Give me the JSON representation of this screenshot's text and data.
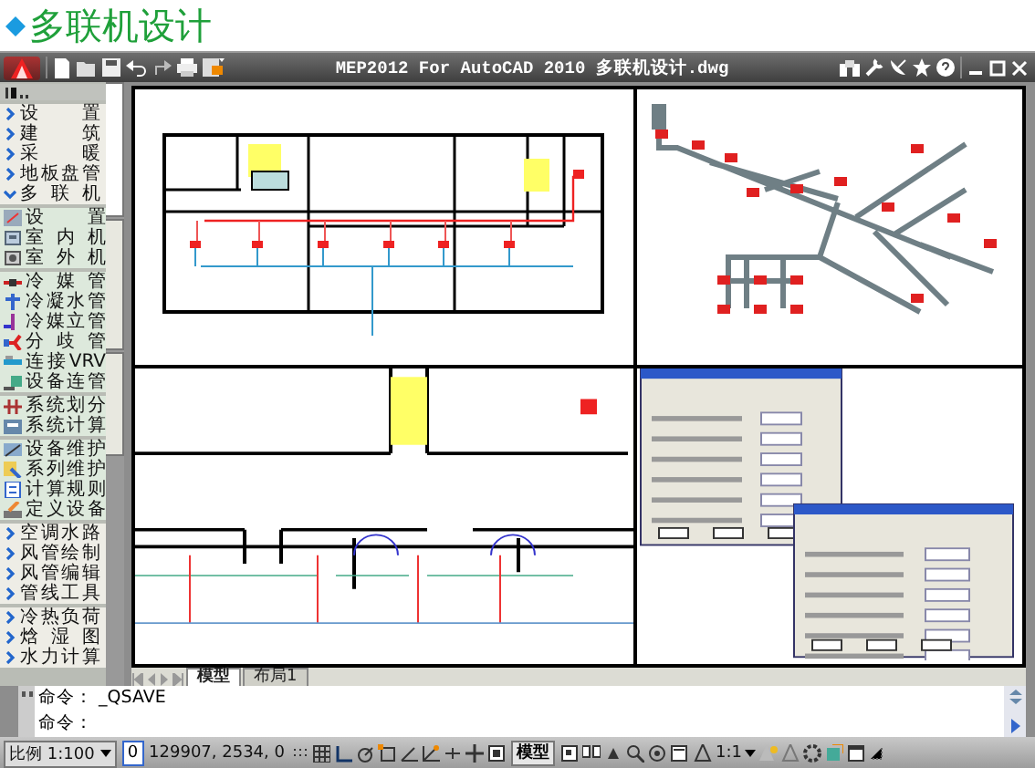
{
  "header": {
    "title": "多联机设计"
  },
  "window": {
    "title": "MEP2012 For AutoCAD 2010  多联机设计.dwg"
  },
  "sidebar": {
    "groups": [
      {
        "items": [
          {
            "kind": "category",
            "label": "设置",
            "expanded": false
          },
          {
            "kind": "category",
            "label": "建筑",
            "expanded": false
          },
          {
            "kind": "category",
            "label": "采暖",
            "expanded": false
          },
          {
            "kind": "category",
            "label": "地板盘管",
            "expanded": false
          },
          {
            "kind": "category",
            "label": "多联机",
            "expanded": true
          }
        ]
      },
      {
        "items": [
          {
            "kind": "tool",
            "label": "设置"
          },
          {
            "kind": "tool",
            "label": "室内机"
          },
          {
            "kind": "tool",
            "label": "室外机"
          }
        ]
      },
      {
        "items": [
          {
            "kind": "tool",
            "label": "冷媒管"
          },
          {
            "kind": "tool",
            "label": "冷凝水管"
          },
          {
            "kind": "tool",
            "label": "冷媒立管"
          },
          {
            "kind": "tool",
            "label": "分歧管"
          },
          {
            "kind": "tool",
            "label": "连接VRV"
          },
          {
            "kind": "tool",
            "label": "设备连管"
          }
        ]
      },
      {
        "items": [
          {
            "kind": "tool",
            "label": "系统划分"
          },
          {
            "kind": "tool",
            "label": "系统计算"
          }
        ]
      },
      {
        "items": [
          {
            "kind": "tool",
            "label": "设备维护"
          },
          {
            "kind": "tool",
            "label": "系列维护"
          },
          {
            "kind": "tool",
            "label": "计算规则"
          },
          {
            "kind": "tool",
            "label": "定义设备"
          }
        ]
      },
      {
        "items": [
          {
            "kind": "category",
            "label": "空调水路",
            "expanded": false
          },
          {
            "kind": "category",
            "label": "风管绘制",
            "expanded": false
          },
          {
            "kind": "category",
            "label": "风管编辑",
            "expanded": false
          },
          {
            "kind": "category",
            "label": "管线工具",
            "expanded": false
          }
        ]
      },
      {
        "items": [
          {
            "kind": "category",
            "label": "冷热负荷",
            "expanded": false
          },
          {
            "kind": "category",
            "label": "焓湿图",
            "expanded": false
          },
          {
            "kind": "category",
            "label": "水力计算",
            "expanded": false
          }
        ]
      }
    ]
  },
  "side_tabs": [
    {
      "selected": true
    },
    {
      "selected": false
    },
    {
      "selected": false
    }
  ],
  "layout_tabs": [
    {
      "label": "模型",
      "selected": true
    },
    {
      "label": "布局1",
      "selected": false
    }
  ],
  "command_lines": [
    "命令： _QSAVE",
    "命令："
  ],
  "status_bar": {
    "scale": "比例 1:100",
    "layer": "0",
    "coordinates": "129907, 2534, 0",
    "space": "模型",
    "annotation_scale": "1:1"
  }
}
